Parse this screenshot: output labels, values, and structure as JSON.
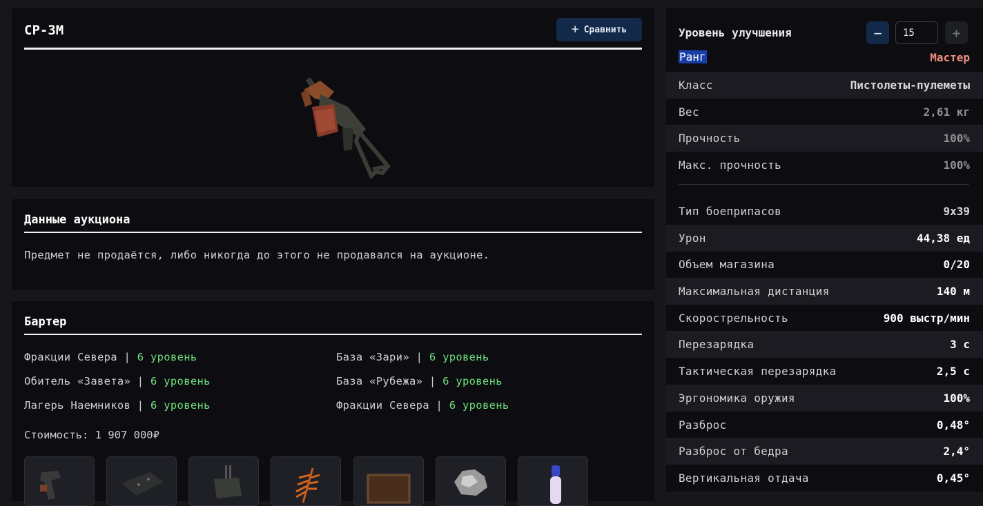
{
  "item": {
    "title": "СР-3М",
    "compare_label": "Сравнить"
  },
  "auction": {
    "title": "Данные аукциона",
    "text": "Предмет не продаётся, либо никогда до этого не продавался на аукционе."
  },
  "barter": {
    "title": "Бартер",
    "sep": "|",
    "rows": [
      {
        "name": "Фракции Севера",
        "level": "6 уровень"
      },
      {
        "name": "База «Зари»",
        "level": "6 уровень"
      },
      {
        "name": "Обитель «Завета»",
        "level": "6 уровень"
      },
      {
        "name": "База «Рубежа»",
        "level": "6 уровень"
      },
      {
        "name": "Лагерь Наемников",
        "level": "6 уровень"
      },
      {
        "name": "Фракции Севера",
        "level": "6 уровень"
      }
    ],
    "cost": "Стоимость: 1 907 000₽"
  },
  "stats": {
    "upgrade_label": "Уровень улучшения",
    "upgrade_value": "15",
    "minus": "−",
    "plus": "+",
    "rank_label": "Ранг",
    "rank_value": "Мастер",
    "rows": [
      {
        "key": "Класс",
        "value": "Пистолеты-пулеметы"
      },
      {
        "key": "Вес",
        "value": "2,61 кг"
      },
      {
        "key": "Прочность",
        "value": "100%"
      },
      {
        "key": "Макс. прочность",
        "value": "100%"
      },
      {
        "key": "Тип боеприпасов",
        "value": "9x39"
      },
      {
        "key": "Урон",
        "value": "44,38 ед"
      },
      {
        "key": "Объем магазина",
        "value": "0/20"
      },
      {
        "key": "Максимальная дистанция",
        "value": "140 м"
      },
      {
        "key": "Скорострельность",
        "value": "900 выстр/мин"
      },
      {
        "key": "Перезарядка",
        "value": "3 с"
      },
      {
        "key": "Тактическая перезарядка",
        "value": "2,5 с"
      },
      {
        "key": "Эргономика оружия",
        "value": "100%"
      },
      {
        "key": "Разброс",
        "value": "0,48°"
      },
      {
        "key": "Разброс от бедра",
        "value": "2,4°"
      },
      {
        "key": "Вертикальная отдача",
        "value": "0,45°"
      }
    ]
  }
}
